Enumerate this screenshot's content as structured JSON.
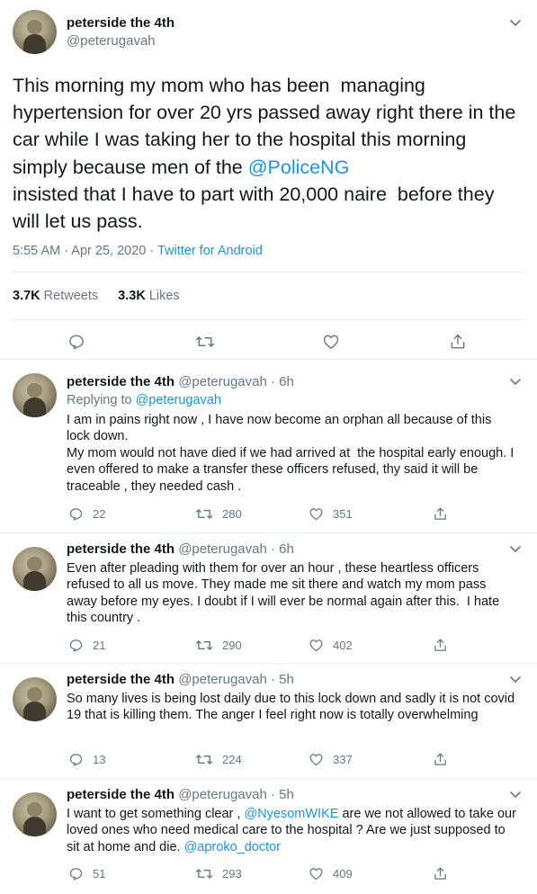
{
  "main_tweet": {
    "name": "peterside the 4th",
    "handle": "@peterugavah",
    "text_before": "This morning my mom who has been  managing hypertension for over 20 yrs passed away right there in the car while I was taking her to the hospital this morning simply because men of the ",
    "mention": "@PoliceNG",
    "text_after": "\ninsisted that I have to part with 20,000 naire  before they will let us pass.",
    "timestamp": "5:55 AM · Apr 25, 2020 · ",
    "source": "Twitter for Android",
    "retweets_count": "3.7K",
    "retweets_label": "Retweets",
    "likes_count": "3.3K",
    "likes_label": "Likes"
  },
  "replies": [
    {
      "name": "peterside the 4th",
      "handle_time": "@peterugavah · 6h",
      "replying_label": "Replying to ",
      "replying_to": "@peterugavah",
      "text": "I am in pains right now , I have now become an orphan all because of this lock down.\nMy mom would not have died if we had arrived at  the hospital early enough. I even offered to make a transfer these officers refused, thy said it will be traceable , they needed cash .",
      "replies": "22",
      "retweets": "280",
      "likes": "351"
    },
    {
      "name": "peterside the 4th",
      "handle_time": "@peterugavah · 6h",
      "text": "Even after pleading with them for over an hour , these heartless officers refused to all us move. They made me sit there and watch my mom pass away before my eyes. I doubt if I will ever be normal again after this.  I hate this country .",
      "replies": "21",
      "retweets": "290",
      "likes": "402"
    },
    {
      "name": "peterside the 4th",
      "handle_time": "@peterugavah · 5h",
      "text": "So many lives is being lost daily due to this lock down and sadly it is not covid 19 that is killing them. The anger I feel right now is totally overwhelming",
      "replies": "13",
      "retweets": "224",
      "likes": "337"
    },
    {
      "name": "peterside the 4th",
      "handle_time": "@peterugavah · 5h",
      "text_before": "I want to get something clear , ",
      "mention1": "@NyesomWIKE",
      "text_middle": " are we not allowed to take our loved ones who need medical care to the hospital ? Are we just supposed to sit at home and die. ",
      "mention2": "@aproko_doctor",
      "replies": "51",
      "retweets": "293",
      "likes": "409"
    }
  ],
  "icons": {
    "reply": "reply-icon",
    "retweet": "retweet-icon",
    "like": "heart-icon",
    "share": "share-icon",
    "more": "chevron-down-icon"
  },
  "colors": {
    "text": "#14171a",
    "secondary": "#657786",
    "link": "#1b95e0",
    "divider": "#e6ecf0"
  }
}
